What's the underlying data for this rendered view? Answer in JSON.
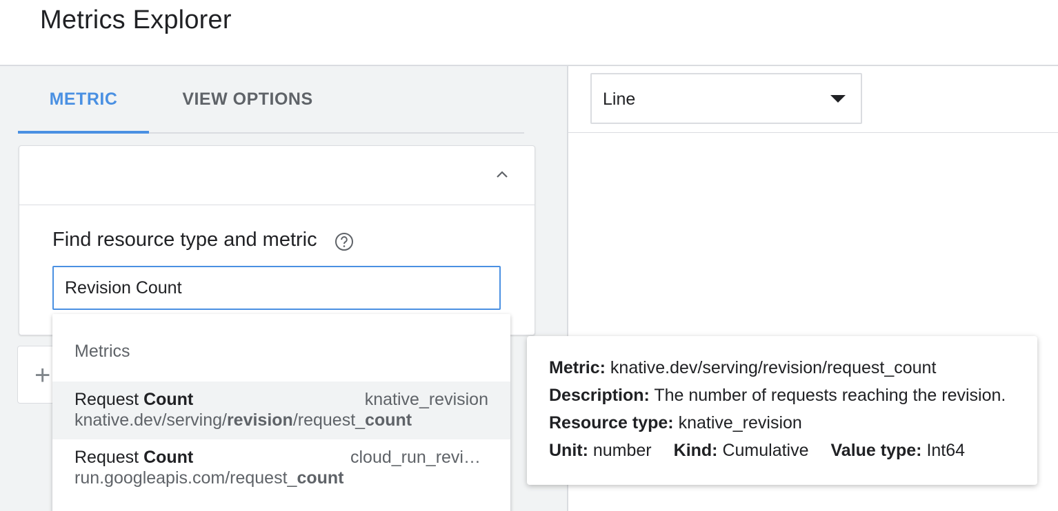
{
  "header": {
    "title": "Metrics Explorer"
  },
  "tabs": [
    {
      "label": "METRIC",
      "active": true
    },
    {
      "label": "VIEW OPTIONS",
      "active": false
    }
  ],
  "find": {
    "label": "Find resource type and metric",
    "input_value": "Revision Count"
  },
  "dropdown": {
    "section_label": "Metrics",
    "items": [
      {
        "name_plain": "Request ",
        "name_bold": "Count",
        "resource": "knative_revision",
        "path_a": "knative.dev/serving/",
        "path_b": "revision",
        "path_c": "/request_",
        "path_d": "count"
      },
      {
        "name_plain": "Request ",
        "name_bold": "Count",
        "resource": "cloud_run_revis…",
        "path_a": "run.googleapis.com/request_",
        "path_b": "count"
      }
    ]
  },
  "chart_type": {
    "value": "Line"
  },
  "tooltip": {
    "metric_label": "Metric:",
    "metric_value": " knative.dev/serving/revision/request_count",
    "description_label": "Description:",
    "description_value": " The number of requests reaching the revision.",
    "resource_label": "Resource type:",
    "resource_value": " knative_revision",
    "unit_label": "Unit:",
    "unit_value": " number",
    "kind_label": "Kind:",
    "kind_value": " Cumulative",
    "valuetype_label": "Value type:",
    "valuetype_value": " Int64"
  },
  "icons": {
    "collapse": "chevron-up-icon",
    "help": "help-circle-icon",
    "add": "plus-icon",
    "select_arrow": "caret-down-icon"
  },
  "colors": {
    "accent": "#4a90e2",
    "panel_bg": "#f1f3f4",
    "divider": "#dadce0"
  }
}
